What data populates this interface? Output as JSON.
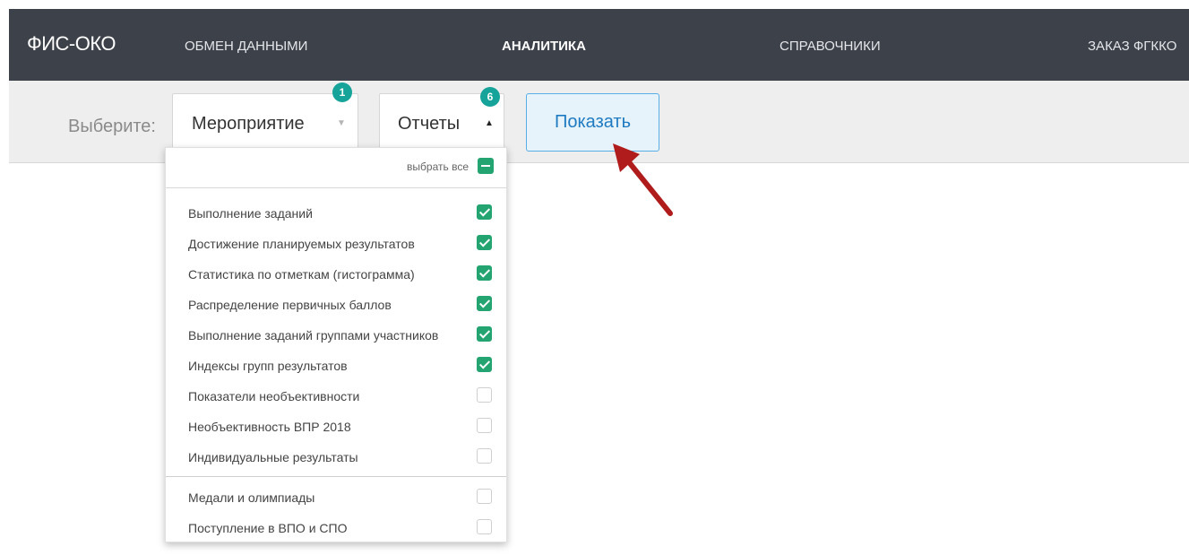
{
  "nav": {
    "brand": "ФИС-ОКО",
    "items": [
      {
        "label": "ОБМЕН ДАННЫМИ",
        "active": false
      },
      {
        "label": "АНАЛИТИКА",
        "active": true
      },
      {
        "label": "СПРАВОЧНИКИ",
        "active": false
      },
      {
        "label": "ЗАКАЗ ФГККО",
        "active": false
      }
    ]
  },
  "filters": {
    "label": "Выберите:",
    "event_select": {
      "value": "Мероприятие",
      "badge": "1"
    },
    "reports_select": {
      "value": "Отчеты",
      "badge": "6",
      "expanded": true
    },
    "show_button": "Показать"
  },
  "dropdown": {
    "select_all": "выбрать все",
    "items": [
      {
        "label": "Выполнение заданий",
        "checked": true
      },
      {
        "label": "Достижение планируемых результатов",
        "checked": true
      },
      {
        "label": "Статистика по отметкам (гистограмма)",
        "checked": true
      },
      {
        "label": "Распределение первичных баллов",
        "checked": true
      },
      {
        "label": "Выполнение заданий группами участников",
        "checked": true
      },
      {
        "label": "Индексы групп результатов",
        "checked": true
      },
      {
        "label": "Показатели необъективности",
        "checked": false
      },
      {
        "label": "Необъективность ВПР 2018",
        "checked": false
      },
      {
        "label": "Индивидуальные результаты",
        "checked": false
      },
      {
        "label": "Медали и олимпиады",
        "checked": false
      },
      {
        "label": "Поступление в ВПО и СПО",
        "checked": false
      }
    ]
  },
  "colors": {
    "navbar": "#3d4149",
    "accent_teal": "#16a39a",
    "checkbox_green": "#23a470",
    "button_blue": "#1f7bc1",
    "annotation_arrow": "#b01c1c"
  }
}
